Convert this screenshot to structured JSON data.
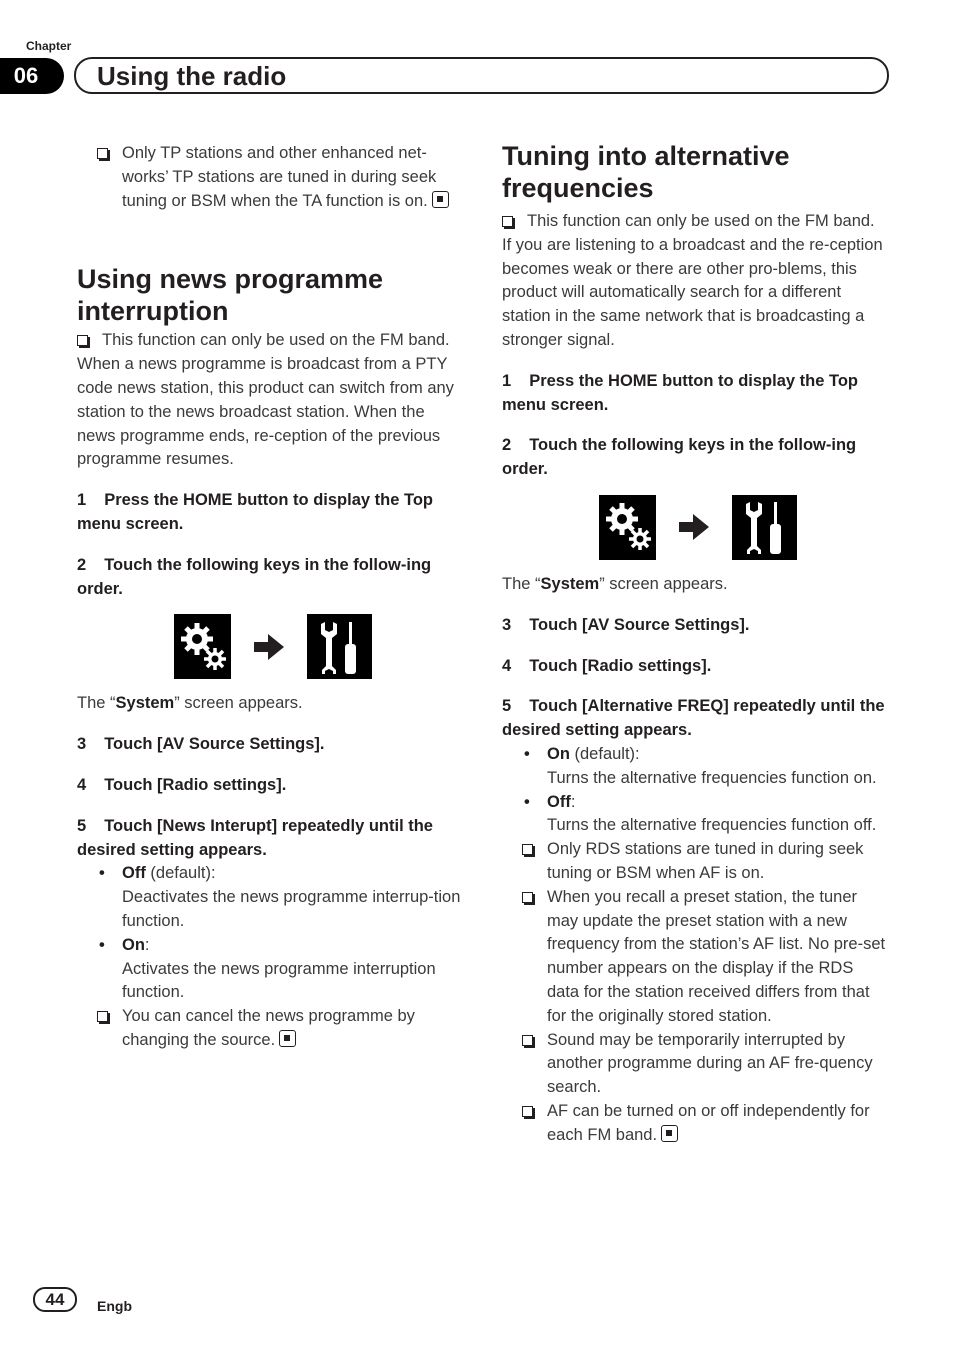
{
  "header": {
    "chapter_label": "Chapter",
    "chapter_number": "06",
    "chapter_title": "Using the radio"
  },
  "left": {
    "top_note": "Only TP stations and other enhanced net-works’ TP stations are tuned in during seek tuning or BSM when the TA function is on.",
    "section_title": "Using news programme interruption",
    "fm_note": "This function can only be used on the FM band.",
    "intro": "When a news programme is broadcast from a PTY code news station, this product can switch from any station to the news broadcast station. When the news programme ends, re-ception of the previous programme resumes.",
    "steps": [
      {
        "n": "1",
        "text": "Press the HOME button to display the Top menu screen."
      },
      {
        "n": "2",
        "text": "Touch the following keys in the follow-ing order."
      },
      {
        "n": "3",
        "text": "Touch [AV Source Settings]."
      },
      {
        "n": "4",
        "text": "Touch [Radio settings]."
      },
      {
        "n": "5",
        "text": "Touch [News Interupt] repeatedly until the desired setting appears."
      }
    ],
    "system_pre": "The “",
    "system_word": "System",
    "system_post": "” screen appears.",
    "options": [
      {
        "label": "Off",
        "suffix": " (default):",
        "desc": "Deactivates the news programme interrup-tion function."
      },
      {
        "label": "On",
        "suffix": ":",
        "desc": "Activates the news programme interruption function."
      }
    ],
    "end_note": "You can cancel the news programme by changing the source."
  },
  "right": {
    "section_title": "Tuning into alternative frequencies",
    "fm_note": "This function can only be used on the FM band.",
    "intro": "If you are listening to a broadcast and the re-ception becomes weak or there are other pro-blems, this product will automatically search for a different station in the same network that is broadcasting a stronger signal.",
    "steps": [
      {
        "n": "1",
        "text": "Press the HOME button to display the Top menu screen."
      },
      {
        "n": "2",
        "text": "Touch the following keys in the follow-ing order."
      },
      {
        "n": "3",
        "text": "Touch [AV Source Settings]."
      },
      {
        "n": "4",
        "text": "Touch [Radio settings]."
      },
      {
        "n": "5",
        "text": "Touch [Alternative FREQ] repeatedly until the desired setting appears."
      }
    ],
    "system_pre": "The “",
    "system_word": "System",
    "system_post": "” screen appears.",
    "options": [
      {
        "label": "On",
        "suffix": " (default):",
        "desc": "Turns the alternative frequencies function on."
      },
      {
        "label": "Off",
        "suffix": ":",
        "desc": "Turns the alternative frequencies function off."
      }
    ],
    "notes": [
      "Only RDS stations are tuned in during seek tuning or BSM when AF is on.",
      "When you recall a preset station, the tuner may update the preset station with a new frequency from the station’s AF list. No pre-set number appears on the display if the RDS data for the station received differs from that for the originally stored station.",
      "Sound may be temporarily interrupted by another programme during an AF fre-quency search.",
      "AF can be turned on or off independently for each FM band."
    ]
  },
  "footer": {
    "page_number": "44",
    "language": "Engb"
  }
}
